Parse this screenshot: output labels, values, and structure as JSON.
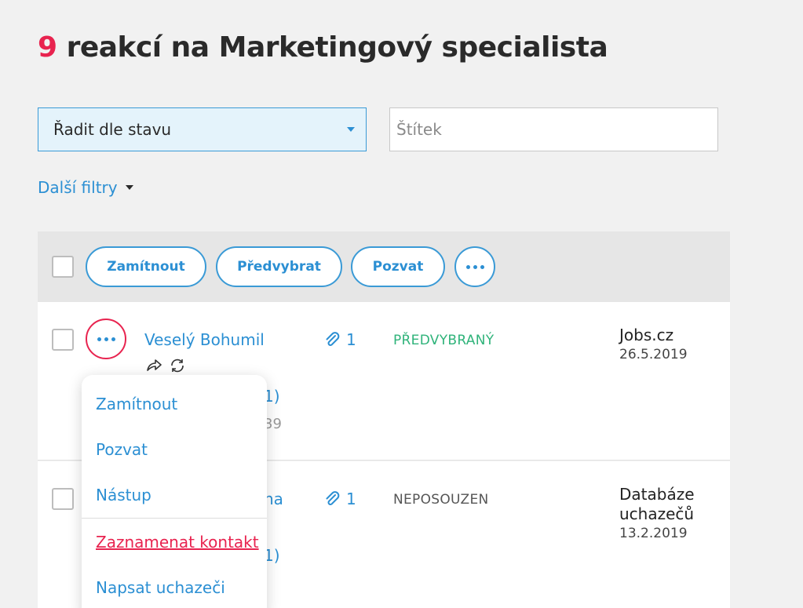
{
  "header": {
    "count": "9",
    "title": "reakcí na Marketingový specialista"
  },
  "filters": {
    "sort_select": "Řadit dle stavu",
    "tag_placeholder": "Štítek",
    "more_filters": "Další filtry"
  },
  "toolbar": {
    "reject": "Zamítnout",
    "preselect": "Předvybrat",
    "invite": "Pozvat"
  },
  "candidates": [
    {
      "name": "Veselý Bohumil",
      "attachments": "1",
      "status": "PŘEDVYBRANÝ",
      "source": "Jobs.cz",
      "date": "26.5.2019",
      "hidden_fragment_1": "1)",
      "hidden_fragment_2": "39"
    },
    {
      "name_fragment": "na",
      "attachments": "1",
      "status": "NEPOSOUZEN",
      "source_line1": "Databáze",
      "source_line2": "uchazečů",
      "date": "13.2.2019",
      "hidden_fragment_1": "1)"
    }
  ],
  "context_menu": {
    "items": [
      "Zamítnout",
      "Pozvat",
      "Nástup",
      "Zaznamenat kontakt",
      "Napsat uchazeči"
    ]
  },
  "colors": {
    "accent_blue": "#2b8fd3",
    "accent_pink": "#e8234f",
    "status_green": "#2fb37a"
  }
}
